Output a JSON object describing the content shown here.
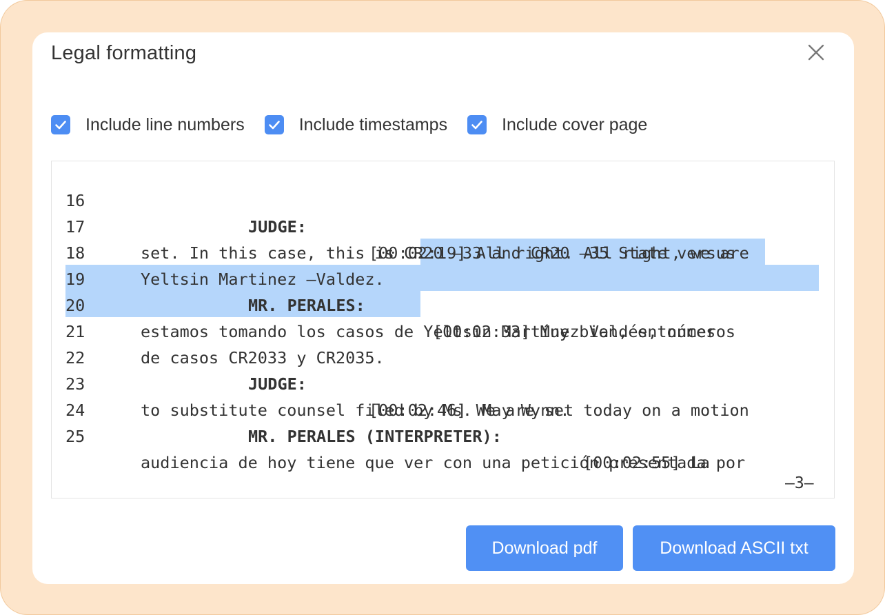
{
  "dialog": {
    "title": "Legal formatting"
  },
  "options": [
    {
      "label": "Include line numbers",
      "checked": true
    },
    {
      "label": "Include timestamps",
      "checked": true
    },
    {
      "label": "Include cover page",
      "checked": true
    }
  ],
  "transcript": {
    "lines": [
      {
        "num": "16",
        "speaker": "JUDGE:",
        "text": "[00:02:19] All right. All right, we are"
      },
      {
        "num": "17",
        "text": "set. In this case, this is CR20 –33 and CR20 –35 State versus"
      },
      {
        "num": "18",
        "text": "Yeltsin Martinez –Valdez."
      },
      {
        "num": "19",
        "speaker": "MR. PERALES:",
        "text": "[00:02:33] Muy bien, entonces"
      },
      {
        "num": "20",
        "text": "estamos tomando los casos de Yeltsin Martínez Valdés, números"
      },
      {
        "num": "21",
        "text": "de casos CR2033 y CR2035."
      },
      {
        "num": "22",
        "speaker": "JUDGE:",
        "text": "[00:02:46] We are set today on a motion"
      },
      {
        "num": "23",
        "text": "to substitute counsel filed by Ms. May Wynn."
      },
      {
        "num": "24",
        "speaker": "MR. PERALES (INTERPRETER):",
        "text": "[00:02:55] La"
      },
      {
        "num": "25",
        "text": "audiencia de hoy tiene que ver con una petición presentada por"
      }
    ],
    "page_number": "–3–"
  },
  "buttons": {
    "download_pdf": "Download pdf",
    "download_ascii": "Download ASCII txt"
  },
  "colors": {
    "accent": "#4d8df3",
    "selection": "#b5d6fb",
    "frame": "#fde5cb"
  }
}
